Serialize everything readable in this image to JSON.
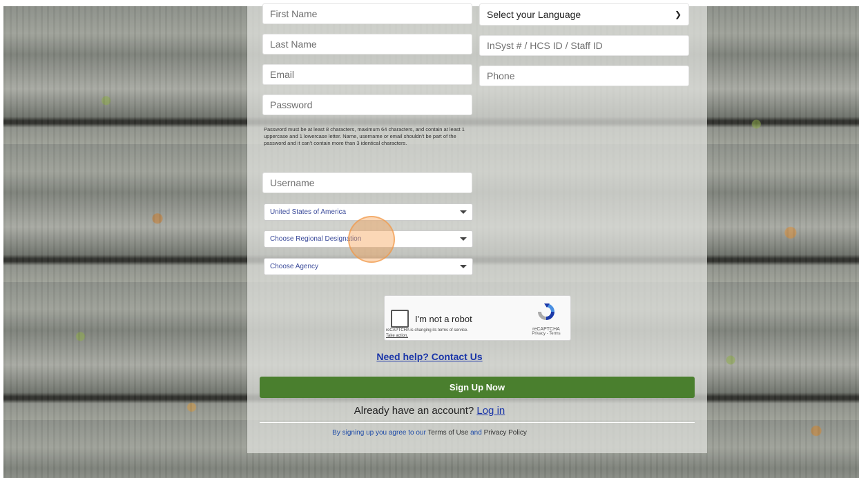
{
  "form": {
    "first_name_placeholder": "First Name",
    "last_name_placeholder": "Last Name",
    "email_placeholder": "Email",
    "password_placeholder": "Password",
    "password_hint": "Password must be at least 8 characters, maximum 64 characters, and contain at least 1 uppercase and 1 lowercase letter. Name, username or email shouldn't be part of the password and it can't contain more than 3 identical characters.",
    "username_placeholder": "Username",
    "language_select": "Select your Language",
    "staff_id_placeholder": "InSyst # / HCS ID / Staff ID",
    "phone_placeholder": "Phone",
    "country_select": "United States of America",
    "region_select": "Choose Regional Designation",
    "agency_select": "Choose Agency"
  },
  "captcha": {
    "label": "I'm not a robot",
    "note": "reCAPTCHA is changing its terms of service.",
    "note_link": "Take action.",
    "brand": "reCAPTCHA",
    "links": "Privacy - Terms"
  },
  "help_link": "Need help? Contact Us",
  "signup_button": "Sign Up Now",
  "login_prompt": "Already have an account?",
  "login_link": "Log in",
  "terms": {
    "prefix": "By signing up you agree to our",
    "terms_link": "Terms of Use",
    "and": "and",
    "privacy_link": "Privacy Policy"
  },
  "colors": {
    "primary_button": "#4a7f2e",
    "link": "#1a35a8"
  }
}
